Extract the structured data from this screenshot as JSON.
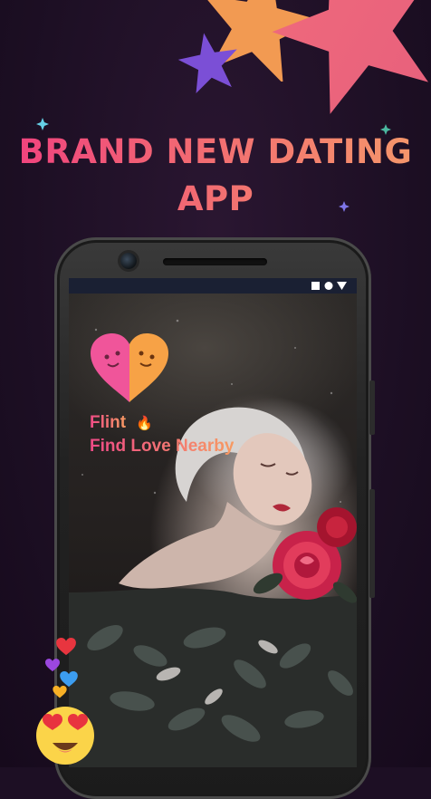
{
  "headline": {
    "line1": "BRAND NEW DATING",
    "line2": "APP"
  },
  "app": {
    "name": "Flint",
    "name_emoji": "🔥",
    "tagline": "Find Love Nearby"
  },
  "status_icons": [
    "square-icon",
    "circle-icon",
    "triangle-down-icon"
  ],
  "reactions": [
    "heart-red-icon",
    "heart-purple-icon",
    "heart-blue-icon",
    "heart-eyes-emoji-icon"
  ],
  "colors": {
    "background": "#1d0f24",
    "accent_pink": "#ef4a86",
    "accent_orange": "#f79a62",
    "star_orange": "#f29a52",
    "star_pink": "#ee5f7c",
    "star_purple": "#7b4fd6"
  }
}
